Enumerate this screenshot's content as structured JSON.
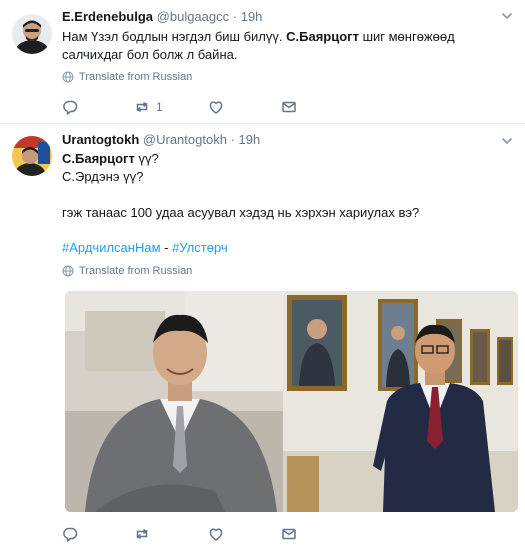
{
  "tweets": [
    {
      "author_name": "E.Erdenebulga",
      "author_handle": "@bulgaagcc",
      "dot": "·",
      "time": "19h",
      "text_part1": "Нам Үзэл бодлын нэгдэл биш билүү. ",
      "text_bold": "С.Баярцогт",
      "text_part2": " шиг мөнгөжөөд салчихдаг бол болж л байна.",
      "translate": "Translate from Russian",
      "retweets": "1"
    },
    {
      "author_name": "Urantogtokh",
      "author_handle": "@Urantogtokh",
      "dot": "·",
      "time": "19h",
      "line1_bold": "С.Баярцогт",
      "line1_rest": " үү?",
      "line2": "С.Эрдэнэ үү?",
      "line3": "гэж танаас 100 удаа асуувал хэдэд нь хэрхэн хариулах вэ?",
      "hashtag1": "#АрдчилсанНам",
      "hashtag_sep": " - ",
      "hashtag2": "#Улстөрч",
      "translate": "Translate from Russian"
    }
  ],
  "icons": {
    "reply": "reply-icon",
    "retweet": "retweet-icon",
    "like": "heart-icon",
    "dm": "envelope-icon",
    "menu": "chevron-down-icon",
    "translate": "globe-icon"
  },
  "colors": {
    "link": "#1da1f2",
    "muted": "#657786",
    "divider": "#e6ecf0"
  }
}
